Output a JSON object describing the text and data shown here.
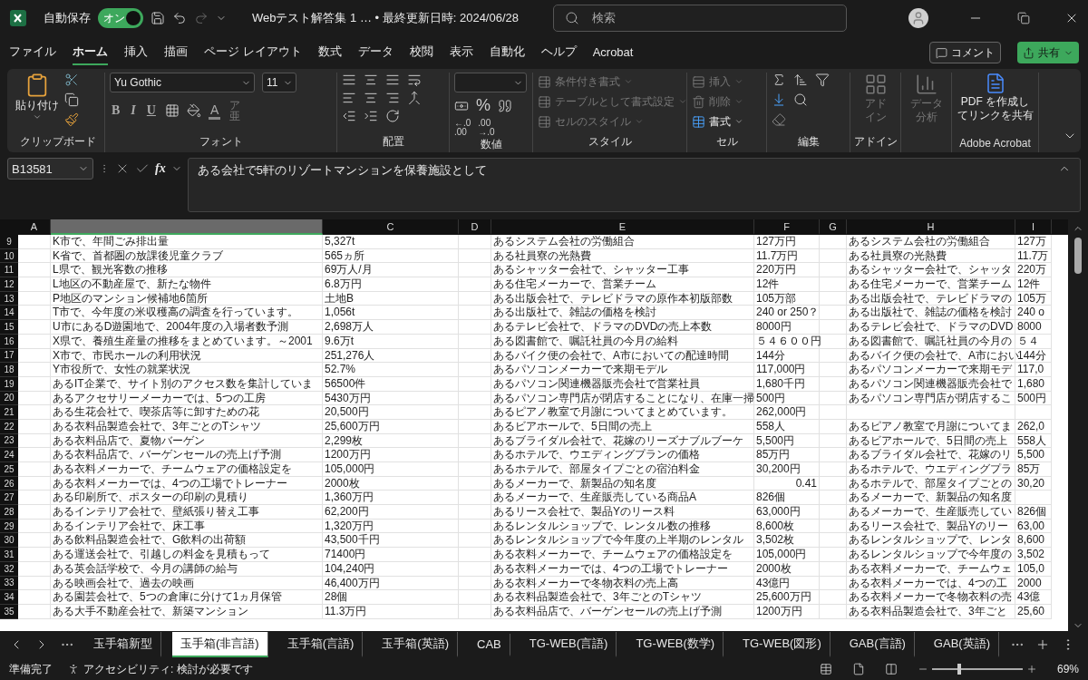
{
  "title_bar": {
    "autosave_label": "自動保存",
    "autosave": {
      "on": true,
      "label": "オン"
    },
    "title": "Webテスト解答集 1 … • 最終更新日時: 2024/06/28",
    "search": {
      "placeholder": "検索"
    }
  },
  "menu_tabs": [
    {
      "label": "ファイル",
      "selected": false
    },
    {
      "label": "ホーム",
      "selected": true
    },
    {
      "label": "挿入",
      "selected": false
    },
    {
      "label": "描画",
      "selected": false
    },
    {
      "label": "ページ レイアウト",
      "selected": false
    },
    {
      "label": "数式",
      "selected": false
    },
    {
      "label": "データ",
      "selected": false
    },
    {
      "label": "校閲",
      "selected": false
    },
    {
      "label": "表示",
      "selected": false
    },
    {
      "label": "自動化",
      "selected": false
    },
    {
      "label": "ヘルプ",
      "selected": false
    },
    {
      "label": "Acrobat",
      "selected": false
    }
  ],
  "comment_button": "コメント",
  "share_button": "共有",
  "ribbon": {
    "clipboard": {
      "label": "クリップボード",
      "paste": "貼り付け"
    },
    "font": {
      "label": "フォント",
      "name": "Yu Gothic",
      "size": "11",
      "styles": [
        "B",
        "I",
        "U"
      ],
      "color_letter": "A",
      "phonetic": "ア亜"
    },
    "alignment": {
      "label": "配置"
    },
    "number": {
      "label": "数値",
      "percent": "%",
      "decimals": [
        {
          "top": "←.0",
          "bottom": ".00"
        },
        {
          "top": ".00",
          "bottom": "→.0"
        }
      ]
    },
    "styles": {
      "label": "スタイル",
      "items": [
        {
          "text": "条件付き書式",
          "disabled": true
        },
        {
          "text": "テーブルとして書式設定",
          "disabled": true
        },
        {
          "text": "セルのスタイル",
          "disabled": true
        }
      ]
    },
    "cells": {
      "label": "セル",
      "items": [
        {
          "text": "挿入",
          "disabled": true
        },
        {
          "text": "削除",
          "disabled": true
        },
        {
          "text": "書式",
          "disabled": false
        }
      ]
    },
    "editing": {
      "label": "編集"
    },
    "addins": {
      "label": "アドイン",
      "button": [
        "アド",
        "イン"
      ],
      "disabled": true
    },
    "analysis": {
      "button": [
        "データ",
        "分析"
      ],
      "disabled": true
    },
    "acrobat": {
      "label": "Adobe Acrobat",
      "button": [
        "PDF を作成し",
        "てリンクを共有"
      ]
    }
  },
  "formula_bar": {
    "name_box": "B13581",
    "fx": "fx",
    "formula": "ある会社で5軒のリゾートマンションを保養施設として"
  },
  "columns": [
    {
      "label": "A",
      "selected": false
    },
    {
      "selected": true
    },
    {
      "label": "C",
      "selected": false
    },
    {
      "label": "D",
      "selected": false
    },
    {
      "label": "E",
      "selected": false
    },
    {
      "label": "F",
      "selected": false
    },
    {
      "label": "G",
      "selected": false
    },
    {
      "label": "H",
      "selected": false
    },
    {
      "label": "I",
      "selected": false
    }
  ],
  "rows": [
    {
      "number": "9",
      "col_b": "K市で、年間ごみ排出量",
      "col_c": "5,327t",
      "col_e": "あるシステム会社の労働組合",
      "col_f": "127万円",
      "col_h": "あるシステム会社の労働組合",
      "col_i": "127万"
    },
    {
      "number": "10",
      "col_b": "K省で、首都圏の放課後児童クラブ",
      "col_c": "565ヵ所",
      "col_e": "ある社員寮の光熱費",
      "col_f": "11.7万円",
      "col_h": "ある社員寮の光熱費",
      "col_i": "11.7万"
    },
    {
      "number": "11",
      "col_b": "L県で、観光客数の推移",
      "col_c": "69万人/月",
      "col_e": "あるシャッター会社で、シャッター工事",
      "col_f": "220万円",
      "col_h": "あるシャッター会社で、シャッタ",
      "col_i": "220万"
    },
    {
      "number": "12",
      "col_b": "L地区の不動産屋で、新たな物件",
      "col_c": "6.8万円",
      "col_e": "ある住宅メーカーで、営業チーム",
      "col_f": "12件",
      "col_h": "ある住宅メーカーで、営業チーム",
      "col_i": "12件"
    },
    {
      "number": "13",
      "col_b": "P地区のマンション候補地6箇所",
      "col_c": "土地B",
      "col_e": "ある出版会社で、テレビドラマの原作本初版部数",
      "col_f": "105万部",
      "col_h": "ある出版会社で、テレビドラマの",
      "col_i": "105万"
    },
    {
      "number": "14",
      "col_b": "T市で、今年度の米収穫高の調査を行っています。",
      "col_c": "1,056t",
      "col_e": "ある出版社で、雑誌の価格を検討",
      "col_f": "240 or 250？",
      "col_h": "ある出版社で、雑誌の価格を検討",
      "col_i": "240 o"
    },
    {
      "number": "15",
      "col_b": "U市にあるD遊園地で、2004年度の入場者数予測",
      "col_c": "2,698万人",
      "col_e": "あるテレビ会社で、ドラマのDVDの売上本数",
      "col_f": "8000円",
      "col_h": "あるテレビ会社で、ドラマのDVD",
      "col_i": "8000"
    },
    {
      "number": "16",
      "col_b": "X県で、養殖生産量の推移をまとめています。～2001",
      "col_c": "9.6万t",
      "col_e": "ある図書館で、嘱託社員の今月の給料",
      "col_f": "５４６００円",
      "col_h": "ある図書館で、嘱託社員の今月の",
      "col_i": "５４"
    },
    {
      "number": "17",
      "col_b": "X市で、市民ホールの利用状況",
      "col_c": "251,276人",
      "col_e": "あるバイク便の会社で、A市においての配達時間",
      "col_f": "144分",
      "col_h": "あるバイク便の会社で、A市におい",
      "col_i": "144分"
    },
    {
      "number": "18",
      "col_b": "Y市役所で、女性の就業状況",
      "col_c": "52.7%",
      "col_e": "あるパソコンメーカーで来期モデル",
      "col_f": "117,000円",
      "col_h": "あるパソコンメーカーで来期モデ",
      "col_i": "117,0"
    },
    {
      "number": "19",
      "col_b": "あるIT企業で、サイト別のアクセス数を集計していま",
      "col_c": "56500件",
      "col_e": "あるパソコン関連機器販売会社で営業社員",
      "col_f": "1,680千円",
      "col_h": "あるパソコン関連機器販売会社で",
      "col_i": "1,680"
    },
    {
      "number": "20",
      "col_b": "あるアクセサリーメーカーでは、5つの工房",
      "col_c": "5430万円",
      "col_e": "あるパソコン専門店が閉店することになり、在庫一掃",
      "col_f": "500円",
      "col_h": "あるパソコン専門店が閉店するこ",
      "col_i": "500円"
    },
    {
      "number": "21",
      "col_b": "ある生花会社で、喫茶店等に卸すための花",
      "col_c": "20,500円",
      "col_e": "あるピアノ教室で月謝についてまとめています。",
      "col_f": "262,000円"
    },
    {
      "number": "22",
      "col_b": "ある衣料品製造会社で、3年ごとのTシャツ",
      "col_c": "25,600万円",
      "col_e": "あるビアホールで、5日間の売上",
      "col_f": "558人",
      "col_h": "あるピアノ教室で月謝についてま",
      "col_i": "262,0"
    },
    {
      "number": "23",
      "col_b": "ある衣料品店で、夏物バーゲン",
      "col_c": "2,299枚",
      "col_e": "あるブライダル会社で、花嫁のリーズナブルブーケ",
      "col_f": "5,500円",
      "col_h": "あるビアホールで、5日間の売上",
      "col_i": "558人"
    },
    {
      "number": "24",
      "col_b": "ある衣料品店で、バーゲンセールの売上げ予測",
      "col_c": "1200万円",
      "col_e": "あるホテルで、ウエディングプランの価格",
      "col_f": "85万円",
      "col_h": "あるブライダル会社で、花嫁のリ",
      "col_i": "5,500"
    },
    {
      "number": "25",
      "col_b": "ある衣料メーカーで、チームウェアの価格設定を",
      "col_c": "105,000円",
      "col_e": "あるホテルで、部屋タイプごとの宿泊料金",
      "col_f": "30,200円",
      "col_h": "あるホテルで、ウエディングプラ",
      "col_i": "85万"
    },
    {
      "number": "26",
      "col_b": "ある衣料メーカーでは、4つの工場でトレーナー",
      "col_c": "2000枚",
      "col_e": "あるメーカーで、新製品の知名度",
      "col_f": {
        "text": "0.41",
        "kind": "number"
      },
      "col_h": "あるホテルで、部屋タイプごとの",
      "col_i": "30,20"
    },
    {
      "number": "27",
      "col_b": "ある印刷所で、ポスターの印刷の見積り",
      "col_c": "1,360万円",
      "col_e": "あるメーカーで、生産販売している商品A",
      "col_f": "826個",
      "col_h": "あるメーカーで、新製品の知名度"
    },
    {
      "number": "28",
      "col_b": "あるインテリア会社で、壁紙張り替え工事",
      "col_c": "62,200円",
      "col_e": "あるリース会社で、製品Yのリース料",
      "col_f": "63,000円",
      "col_h": "あるメーカーで、生産販売してい",
      "col_i": "826個"
    },
    {
      "number": "29",
      "col_b": "あるインテリア会社で、床工事",
      "col_c": "1,320万円",
      "col_e": "あるレンタルショップで、レンタル数の推移",
      "col_f": "8,600枚",
      "col_h": "あるリース会社で、製品Yのリー",
      "col_i": "63,00"
    },
    {
      "number": "30",
      "col_b": "ある飲料品製造会社で、G飲料の出荷額",
      "col_c": "43,500千円",
      "col_e": "あるレンタルショップで今年度の上半期のレンタル",
      "col_f": "3,502枚",
      "col_h": "あるレンタルショップで、レンタ",
      "col_i": "8,600"
    },
    {
      "number": "31",
      "col_b": "ある運送会社で、引越しの料金を見積もって",
      "col_c": "71400円",
      "col_e": "ある衣料メーカーで、チームウェアの価格設定を",
      "col_f": "105,000円",
      "col_h": "あるレンタルショップで今年度の",
      "col_i": "3,502"
    },
    {
      "number": "32",
      "col_b": "ある英会話学校で、今月の講師の給与",
      "col_c": "104,240円",
      "col_e": "ある衣料メーカーでは、4つの工場でトレーナー",
      "col_f": "2000枚",
      "col_h": "ある衣料メーカーで、チームウェ",
      "col_i": "105,0"
    },
    {
      "number": "33",
      "col_b": "ある映画会社で、過去の映画",
      "col_c": "46,400万円",
      "col_e": "ある衣料メーカーで冬物衣料の売上高",
      "col_f": "43億円",
      "col_h": "ある衣料メーカーでは、4つの工",
      "col_i": "2000"
    },
    {
      "number": "34",
      "col_b": "ある園芸会社で、5つの倉庫に分けて1ヵ月保管",
      "col_c": "28個",
      "col_e": "ある衣料品製造会社で、3年ごとのTシャツ",
      "col_f": "25,600万円",
      "col_h": "ある衣料メーカーで冬物衣料の売",
      "col_i": "43億"
    },
    {
      "number": "35",
      "col_b": "ある大手不動産会社で、新築マンション",
      "col_c": "11.3万円",
      "col_e": "ある衣料品店で、バーゲンセールの売上げ予測",
      "col_f": "1200万円",
      "col_h": "ある衣料品製造会社で、3年ごと",
      "col_i": "25,60"
    }
  ],
  "sheet_tabs": [
    {
      "label": "玉手箱新型",
      "selected": false
    },
    {
      "label": "玉手箱(非言語)",
      "selected": true
    },
    {
      "label": "玉手箱(言語)",
      "selected": false
    },
    {
      "label": "玉手箱(英語)",
      "selected": false
    },
    {
      "label": "CAB",
      "selected": false
    },
    {
      "label": "TG-WEB(言語)",
      "selected": false
    },
    {
      "label": "TG-WEB(数学)",
      "selected": false
    },
    {
      "label": "TG-WEB(図形)",
      "selected": false
    },
    {
      "label": "GAB(言語)",
      "selected": false
    },
    {
      "label": "GAB(英語)",
      "selected": false
    }
  ],
  "status_bar": {
    "ready": "準備完了",
    "accessibility": "アクセシビリティ: 検討が必要です",
    "zoom": {
      "level": 0.3,
      "label": "69%"
    }
  }
}
